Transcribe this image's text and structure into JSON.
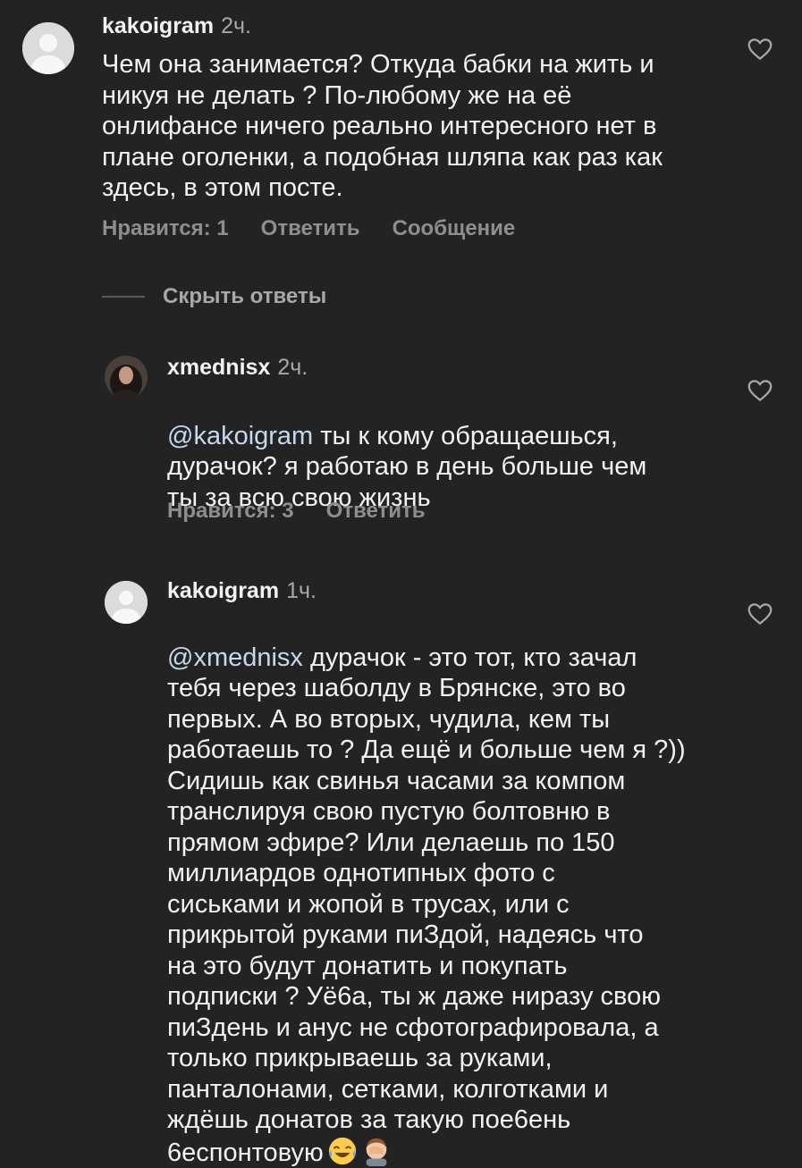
{
  "comments": [
    {
      "username": "kakoigram",
      "time": "2ч.",
      "text": "Чем она занимается? Откуда бабки на жить и\nникуя не делать ? По-любому же на её\nонлифансе ничего реально интересного нет в\nплане оголенки, а подобная шляпа как раз как\nздесь, в этом посте.",
      "likes_label": "Нравится: 1",
      "reply_label": "Ответить",
      "message_label": "Сообщение"
    }
  ],
  "hide_replies_label": "Скрыть ответы",
  "replies": [
    {
      "username": "xmednisx",
      "time": "2ч.",
      "mention": "@kakoigram",
      "text": " ты к кому обращаешься,\nдурачок? я работаю в день больше чем\nты за всю свою жизнь",
      "likes_label": "Нравится: 3",
      "reply_label": "Ответить"
    },
    {
      "username": "kakoigram",
      "time": "1ч.",
      "mention": "@xmednisx",
      "text": " дурачок - это тот, кто зачал\nтебя через шаболду в Брянске, это во\nпервых. А во вторых, чудила, кем ты\nработаешь то ? Да ещё и больше чем я ?))\nСидишь как свинья часами за компом\nтранслируя свою пустую болтовню в\nпрямом эфире? Или делаешь по 150\nмиллиардов однотипных фото с\nсиськами и жопой в трусах, или с\nприкрытой руками пиЗдой, надеясь что\nна это будут донатить и покупать\nподписки ? Уё6а, ты ж даже ниразу свою\nпиЗдень и анус не сфотографировала, а\nтолько прикрываешь за руками,\nпанталонами, сетками, колготками и\nждёшь донатов за такую пое6ень\n6еспонтовую"
    }
  ],
  "icons": {
    "like": "heart-outline-icon",
    "avatar_placeholder": "default-avatar-icon",
    "emoji_1": "face-with-tears-of-joy-emoji",
    "emoji_2": "man-facepalming-emoji"
  },
  "colors": {
    "background": "#232323",
    "text": "#f2f2f2",
    "muted": "#8e8e8e",
    "mention": "#c7d8ee"
  }
}
